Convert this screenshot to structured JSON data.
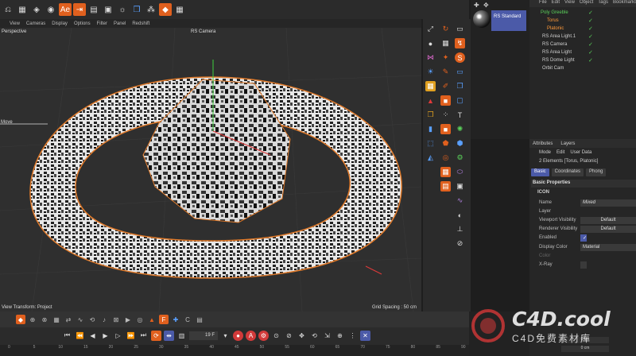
{
  "menu": [
    "View",
    "Cameras",
    "Display",
    "Options",
    "Filter",
    "Panel",
    "Redshift"
  ],
  "viewport": {
    "label": "Perspective",
    "camera": "RS Camera",
    "move_label": "Move",
    "view_transform": "View Transform: Project",
    "grid_spacing": "Grid Spacing : 50 cm"
  },
  "material": {
    "name": "RS Standard"
  },
  "object_manager": {
    "menu": [
      "File",
      "Edit",
      "View",
      "Object",
      "Tags",
      "Bookmarks"
    ],
    "objects": [
      {
        "name": "Poly Greeble",
        "color": "#5ad05a"
      },
      {
        "name": "Torus",
        "color": "#ff9a3a"
      },
      {
        "name": "Platonic",
        "color": "#ff9a3a"
      },
      {
        "name": "RS Area Light.1",
        "color": "#dddddd"
      },
      {
        "name": "RS Camera",
        "color": "#dddddd"
      },
      {
        "name": "RS Area Light",
        "color": "#dddddd"
      },
      {
        "name": "RS Dome Light",
        "color": "#dddddd"
      },
      {
        "name": "Orbit Cam",
        "color": "#dddddd"
      }
    ]
  },
  "attributes": {
    "tabs": [
      "Attributes",
      "Layers"
    ],
    "menu": [
      "Mode",
      "Edit",
      "User Data"
    ],
    "title": "2 Elements [Torus, Platonic]",
    "subtabs": [
      "Basic",
      "Coordinates",
      "Phong"
    ],
    "section": "Basic Properties",
    "group": "ICON",
    "rows": [
      {
        "label": "Name",
        "value": "Mixed"
      },
      {
        "label": "Layer",
        "value": ""
      },
      {
        "label": "Viewport Visibility",
        "value": "Default"
      },
      {
        "label": "Renderer Visibility",
        "value": "Default"
      },
      {
        "label": "Enabled",
        "value": "✓"
      },
      {
        "label": "Display Color",
        "value": "Material"
      },
      {
        "label": "Color",
        "value": ""
      },
      {
        "label": "X-Ray",
        "value": ""
      }
    ]
  },
  "timeline": {
    "frame": "19 F",
    "ticks": [
      "0",
      "5",
      "10",
      "15",
      "20",
      "25",
      "30",
      "35",
      "40",
      "45",
      "50",
      "55",
      "60",
      "65",
      "70",
      "75",
      "80",
      "85",
      "90"
    ]
  },
  "coords": [
    "0 cm",
    "0 cm"
  ],
  "watermark": {
    "main": "C4D.cool",
    "sub": "C4D免费素材库"
  }
}
